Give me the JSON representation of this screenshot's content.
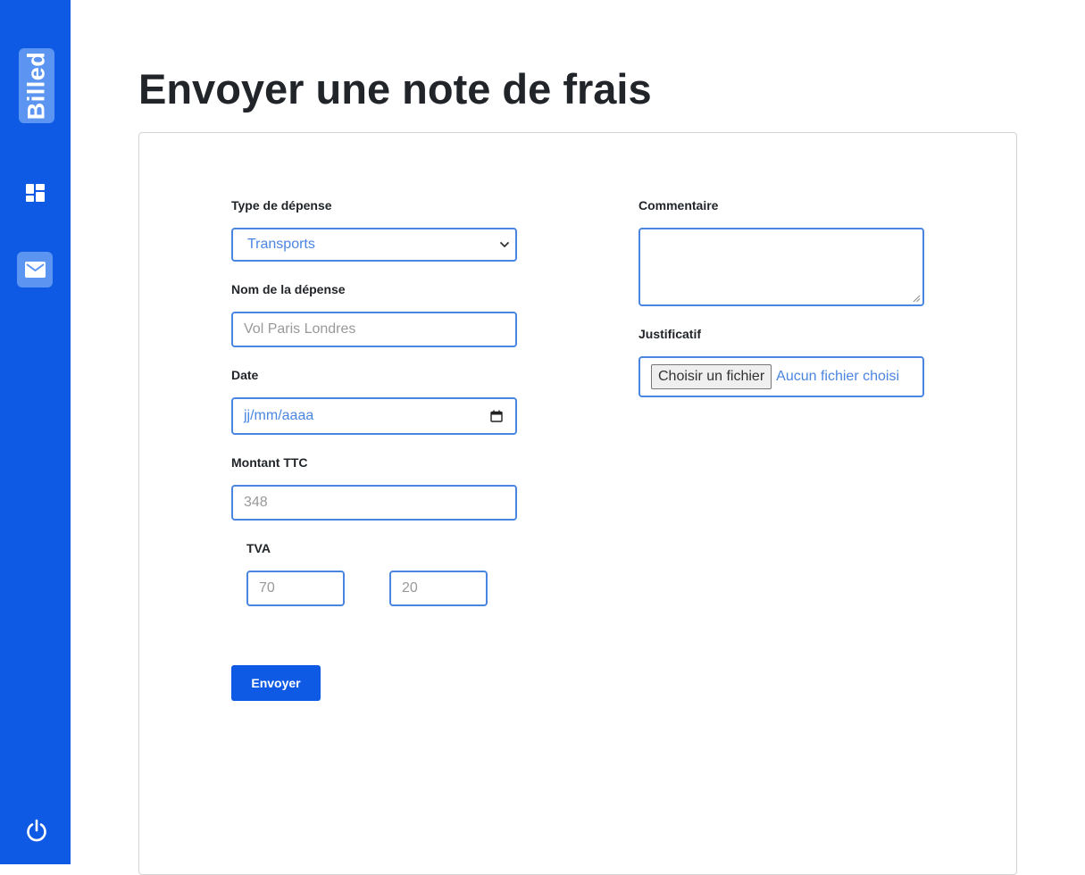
{
  "sidebar": {
    "logo_text": "Billed",
    "icons": [
      "windows-icon",
      "mail-icon",
      "power-icon"
    ],
    "colors": {
      "background": "#0e5ae5",
      "active_item": "#5b95f1"
    }
  },
  "page": {
    "title": "Envoyer une note de frais"
  },
  "form": {
    "expense_type": {
      "label": "Type de dépense",
      "value": "Transports"
    },
    "expense_name": {
      "label": "Nom de la dépense",
      "placeholder": "Vol Paris Londres"
    },
    "date": {
      "label": "Date",
      "placeholder": "jj/mm/aaaa"
    },
    "amount": {
      "label": "Montant TTC",
      "placeholder": "348"
    },
    "vat": {
      "label": "TVA",
      "amount_placeholder": "70",
      "percent_placeholder": "20"
    },
    "comment": {
      "label": "Commentaire",
      "value": ""
    },
    "receipt": {
      "label": "Justificatif",
      "button_label": "Choisir un fichier",
      "status": "Aucun fichier choisi"
    },
    "submit_label": "Envoyer",
    "colors": {
      "field_border": "#4a86e1",
      "submit": "#0e5ae5"
    }
  }
}
